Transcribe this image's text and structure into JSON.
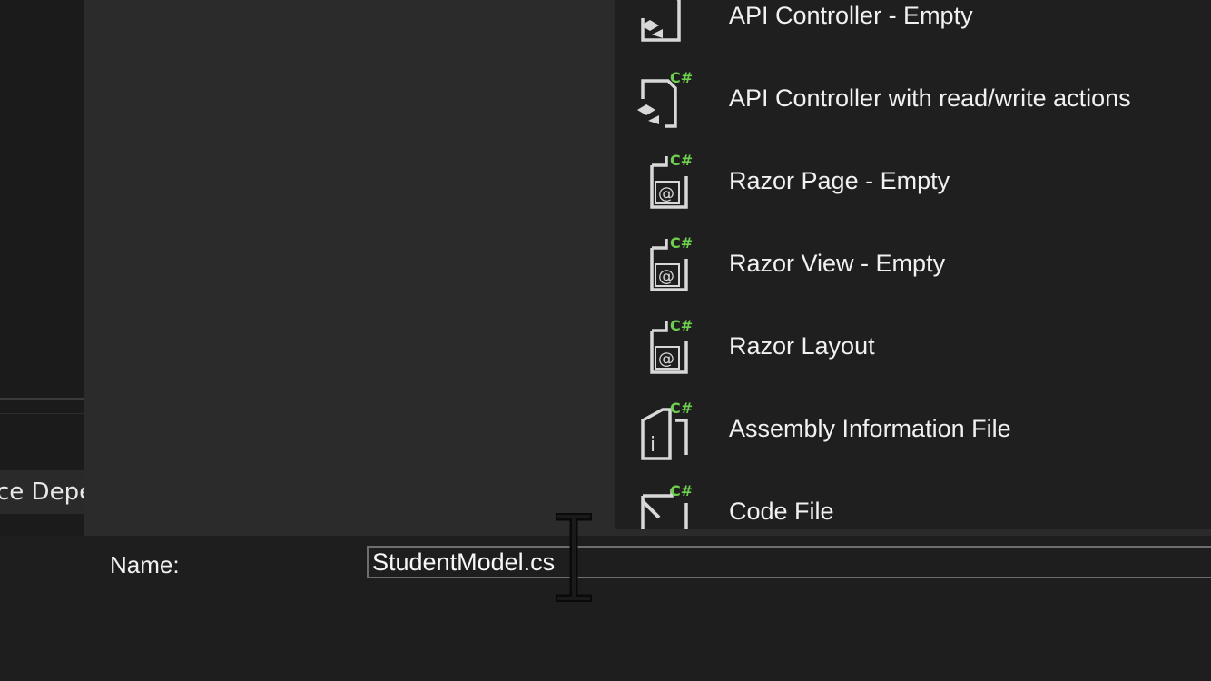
{
  "background": {
    "side_tab_text": "ce Depe"
  },
  "templates": [
    {
      "label": "API Controller - Empty",
      "icon": "api-controller-icon"
    },
    {
      "label": "API Controller with read/write actions",
      "icon": "api-controller-icon"
    },
    {
      "label": "Razor Page - Empty",
      "icon": "razor-file-icon"
    },
    {
      "label": "Razor View - Empty",
      "icon": "razor-file-icon"
    },
    {
      "label": "Razor Layout",
      "icon": "razor-file-icon"
    },
    {
      "label": "Assembly Information File",
      "icon": "info-file-icon"
    },
    {
      "label": "Code File",
      "icon": "code-file-icon"
    }
  ],
  "icon_badge": "C#",
  "form": {
    "name_label": "Name:",
    "name_value": "StudentModel.cs"
  },
  "colors": {
    "csharp_badge": "#6fcf4f",
    "icon_stroke": "#d8d8d8",
    "list_background": "#1f1f1f",
    "dialog_background": "#252526"
  }
}
